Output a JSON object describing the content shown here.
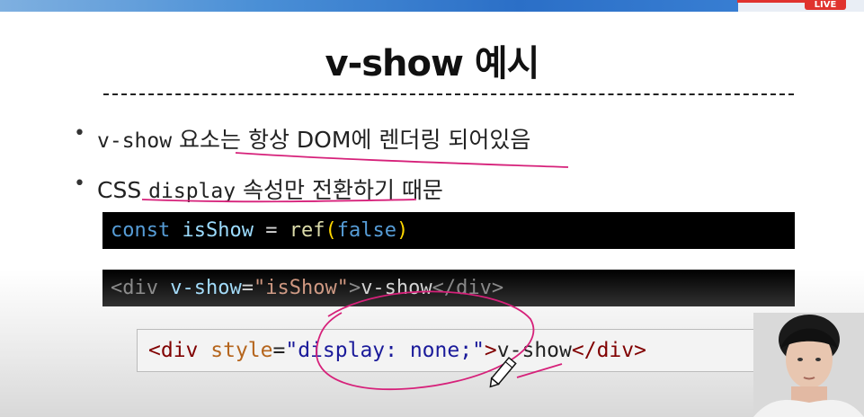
{
  "stream": {
    "live_label": "LIVE"
  },
  "slide": {
    "title": "v-show 예시",
    "bullets": [
      {
        "code": "v-show",
        "text": " 요소는 항상 DOM에 렌더링 되어있음"
      },
      {
        "lead": "CSS ",
        "code": "display",
        "text": " 속성만 전환하기 때문"
      }
    ]
  },
  "code_line_1": {
    "const": "const",
    "name": "isShow",
    "eq": " = ",
    "fn": "ref",
    "open": "(",
    "arg": "false",
    "close": ")"
  },
  "code_line_2": {
    "open_tag": "<div ",
    "attr": "v-show",
    "eq": "=",
    "value": "\"isShow\"",
    "gt": ">",
    "content": "v-show",
    "close_tag": "</div>"
  },
  "rendered_html": {
    "open_tag": "<div ",
    "attr": "style",
    "eq": "=",
    "value": "\"display: none;\"",
    "gt": ">",
    "content": "v-show",
    "close_tag": "</div>"
  },
  "colors": {
    "accent_pen": "#d6217a",
    "code_bg": "#000000",
    "live_red": "#e0332e"
  },
  "icons": [
    "pencil-cursor-icon"
  ]
}
